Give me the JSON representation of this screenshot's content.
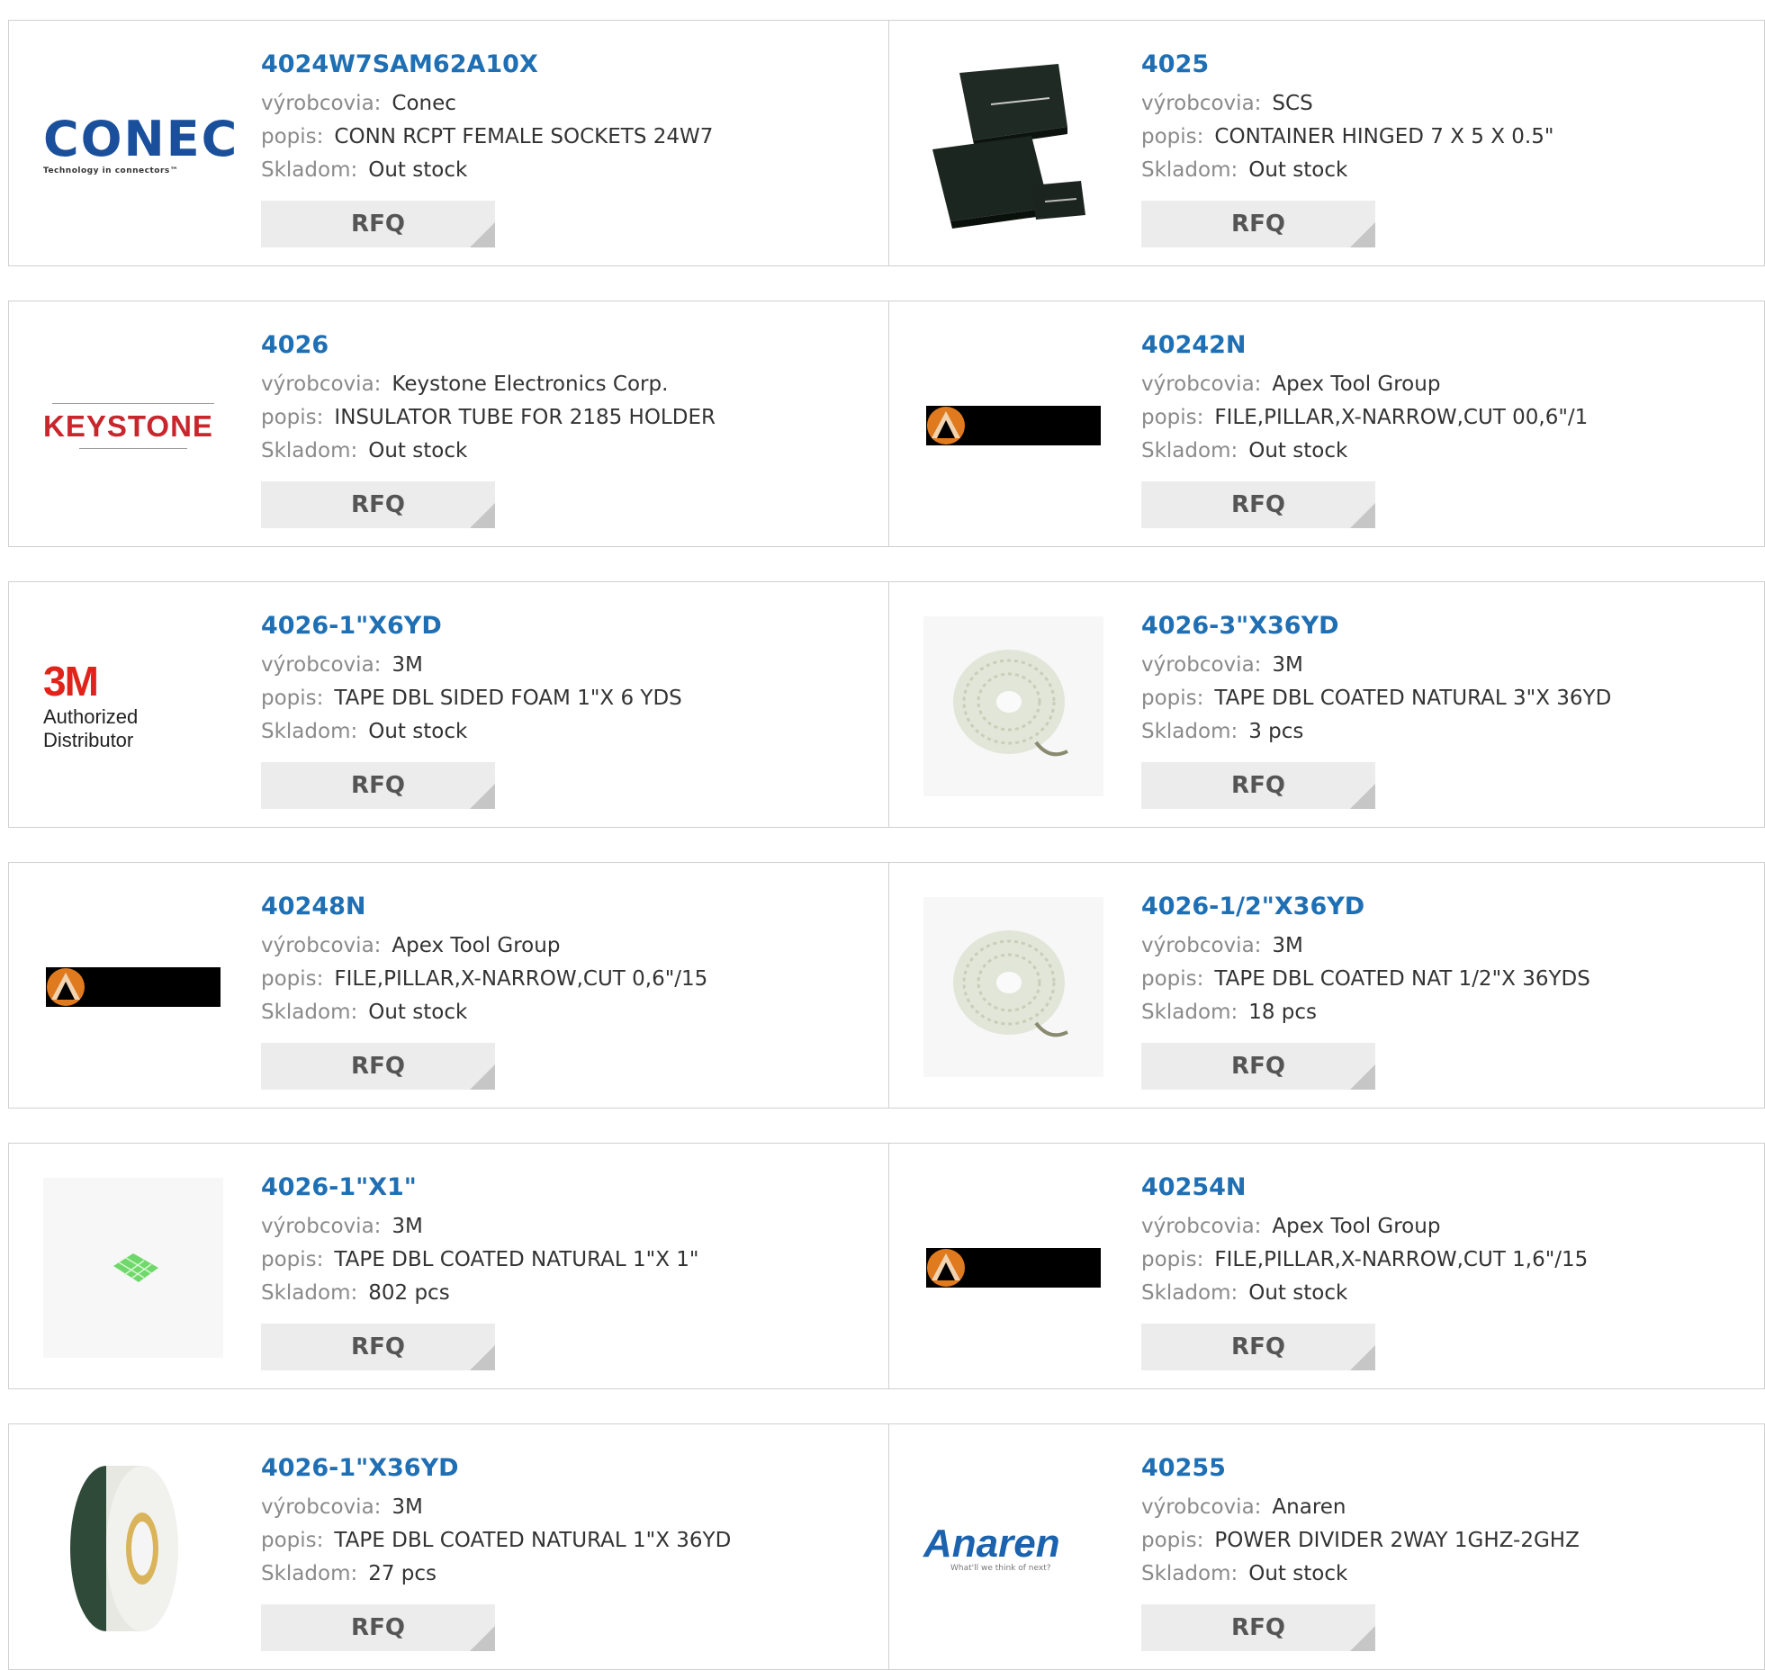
{
  "labels": {
    "manufacturer": "výrobcovia:",
    "description": "popis:",
    "stock": "Skladom:",
    "rfq": "RFQ"
  },
  "rows": [
    [
      {
        "part": "4024W7SAM62A10X",
        "manufacturer": "Conec",
        "description": "CONN RCPT FEMALE SOCKETS 24W7",
        "stock": "Out stock",
        "image": "conec-logo",
        "logo_text": "CONEC",
        "logo_sub": "Technology in connectors™"
      },
      {
        "part": "4025",
        "manufacturer": "SCS",
        "description": "CONTAINER HINGED 7 X 5 X 0.5\"",
        "stock": "Out stock",
        "image": "black-containers-photo"
      }
    ],
    [
      {
        "part": "4026",
        "manufacturer": "Keystone Electronics Corp.",
        "description": "INSULATOR TUBE FOR 2185 HOLDER",
        "stock": "Out stock",
        "image": "keystone-logo",
        "logo_text": "KEYSTONE"
      },
      {
        "part": "40242N",
        "manufacturer": "Apex Tool Group",
        "description": "FILE,PILLAR,X-NARROW,CUT 00,6\"/1",
        "stock": "Out stock",
        "image": "apex-logo"
      }
    ],
    [
      {
        "part": "4026-1\"X6YD",
        "manufacturer": "3M",
        "description": "TAPE DBL SIDED FOAM 1\"X 6 YDS",
        "stock": "Out stock",
        "image": "3m-logo",
        "logo_text": "3M",
        "logo_sub": "Authorized Distributor"
      },
      {
        "part": "4026-3\"X36YD",
        "manufacturer": "3M",
        "description": "TAPE DBL COATED NATURAL 3\"X 36YD",
        "stock": "3 pcs",
        "image": "tape-roll-photo"
      }
    ],
    [
      {
        "part": "40248N",
        "manufacturer": "Apex Tool Group",
        "description": "FILE,PILLAR,X-NARROW,CUT 0,6\"/15",
        "stock": "Out stock",
        "image": "apex-logo"
      },
      {
        "part": "4026-1/2\"X36YD",
        "manufacturer": "3M",
        "description": "TAPE DBL COATED NAT 1/2\"X 36YDS",
        "stock": "18 pcs",
        "image": "tape-roll-photo"
      }
    ],
    [
      {
        "part": "4026-1\"X1\"",
        "manufacturer": "3M",
        "description": "TAPE DBL COATED NATURAL 1\"X 1\"",
        "stock": "802 pcs",
        "image": "tape-square-photo"
      },
      {
        "part": "40254N",
        "manufacturer": "Apex Tool Group",
        "description": "FILE,PILLAR,X-NARROW,CUT 1,6\"/15",
        "stock": "Out stock",
        "image": "apex-logo"
      }
    ],
    [
      {
        "part": "4026-1\"X36YD",
        "manufacturer": "3M",
        "description": "TAPE DBL COATED NATURAL 1\"X 36YD",
        "stock": "27 pcs",
        "image": "tape-roll-side-photo"
      },
      {
        "part": "40255",
        "manufacturer": "Anaren",
        "description": "POWER DIVIDER 2WAY 1GHZ-2GHZ",
        "stock": "Out stock",
        "image": "anaren-logo",
        "logo_text": "Anaren",
        "logo_sub": "What'll we think of next?"
      }
    ]
  ]
}
